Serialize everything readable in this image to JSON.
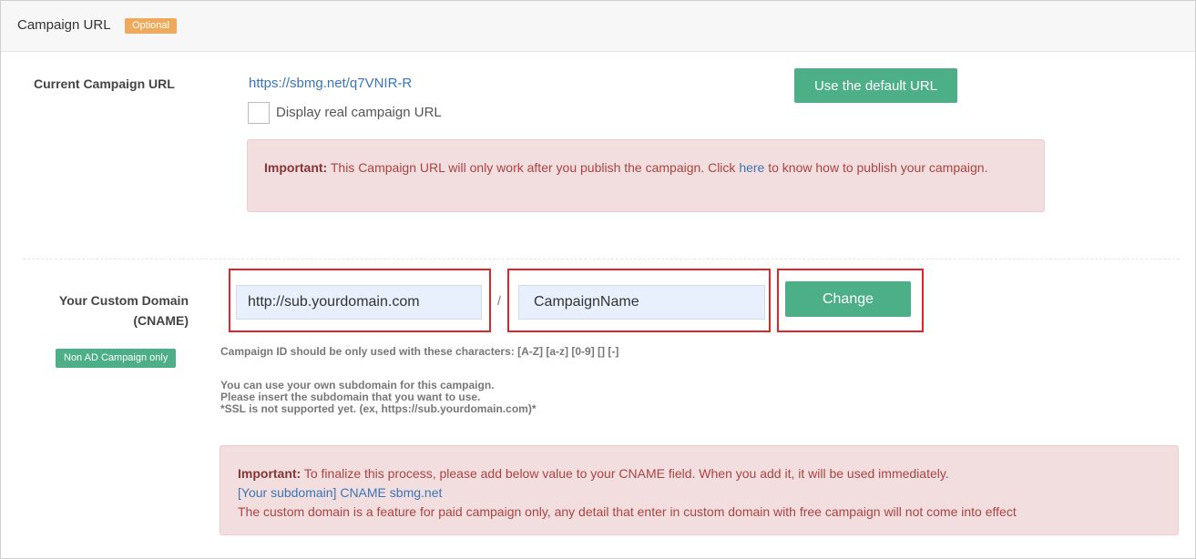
{
  "header": {
    "title": "Campaign URL",
    "optional_badge": "Optional"
  },
  "campaign_url": {
    "label": "Current Campaign URL",
    "url": "https://sbmg.net/q7VNIR-R",
    "use_default_button": "Use the default URL",
    "display_real_checkbox_label": "Display real campaign URL",
    "display_real_checked": false,
    "alert": {
      "strong": "Important:",
      "text_before_link": " This Campaign URL will only work after you publish the campaign. Click ",
      "link": "here",
      "text_after_link": " to know how to publish your campaign."
    }
  },
  "custom_domain": {
    "label_line1": "Your Custom Domain",
    "label_line2": "(CNAME)",
    "badge": "Non AD Campaign only",
    "domain_value": "http://sub.yourdomain.com",
    "separator": "/",
    "campaign_name_value": "CampaignName",
    "change_button": "Change",
    "charset_hint": "Campaign ID should be only used with these characters: [A-Z] [a-z] [0-9] [] [-]",
    "note_lines": [
      "You can use your own subdomain for this campaign.",
      "Please insert the subdomain that you want to use.",
      "*SSL is not supported yet. (ex, https://sub.yourdomain.com)*"
    ],
    "alert": {
      "strong": "Important:",
      "text": " To finalize this process, please add below value to your CNAME field. When you add it, it will be used immediately.",
      "cname_line": "[Your subdomain] CNAME sbmg.net",
      "paid_note": "The custom domain is a feature for paid campaign only, any detail that enter in custom domain with free campaign will not come into effect"
    }
  },
  "colors": {
    "accent_green": "#4caf87",
    "optional_orange": "#eeaa5a",
    "alert_bg": "#f2dede",
    "alert_text": "#a94442",
    "link_blue": "#3c74b5",
    "highlight_red": "#e0262a"
  }
}
